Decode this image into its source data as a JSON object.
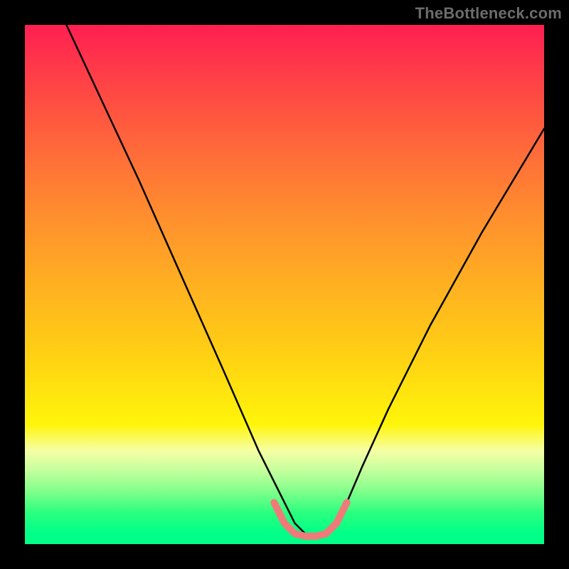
{
  "watermark": "TheBottleneck.com",
  "chart_data": {
    "type": "line",
    "title": "",
    "xlabel": "",
    "ylabel": "",
    "xlim": [
      0,
      100
    ],
    "ylim": [
      0,
      100
    ],
    "background_gradient_top_color": "#ff1f52",
    "background_gradient_bottom_color": "#00ff88",
    "series": [
      {
        "name": "black-curve",
        "color": "#000000",
        "x": [
          8,
          15,
          22,
          30,
          38,
          45,
          50,
          52,
          54,
          56,
          58,
          60,
          62,
          65,
          70,
          78,
          88,
          100
        ],
        "y": [
          100,
          85,
          70,
          52,
          34,
          18,
          8,
          4,
          2,
          1.5,
          2,
          4,
          8,
          15,
          26,
          42,
          60,
          80
        ]
      },
      {
        "name": "pink-bottom-curve",
        "color": "#f07a7a",
        "x": [
          48,
          50,
          52,
          54,
          56,
          58,
          60,
          62
        ],
        "y": [
          8,
          4,
          2,
          1.5,
          1.5,
          2,
          4,
          8
        ]
      }
    ]
  }
}
